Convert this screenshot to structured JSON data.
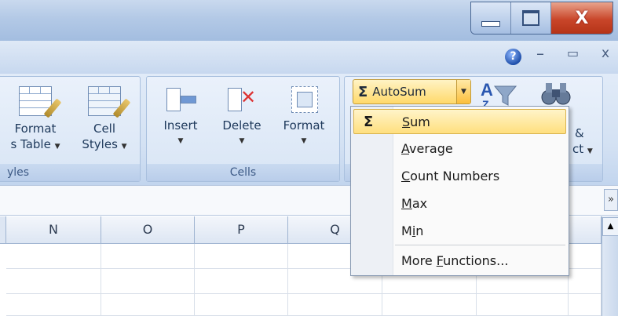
{
  "window": {
    "close_glyph": "X"
  },
  "ribbon": {
    "styles_group": {
      "label": "yles",
      "format_table_line1": "Format",
      "format_table_line2": "s Table",
      "cell_styles_line1": "Cell",
      "cell_styles_line2": "Styles"
    },
    "cells_group": {
      "label": "Cells",
      "insert": "Insert",
      "delete": "Delete",
      "format": "Format"
    },
    "editing_group": {
      "autosum_label": "AutoSum",
      "sort_partial": "&",
      "find_partial": "ct"
    }
  },
  "grid": {
    "columns": [
      "N",
      "O",
      "P",
      "Q"
    ]
  },
  "autosum_menu": {
    "items": [
      {
        "prefix": "",
        "accel": "S",
        "suffix": "um",
        "highlighted": true
      },
      {
        "prefix": "",
        "accel": "A",
        "suffix": "verage"
      },
      {
        "prefix": "",
        "accel": "C",
        "suffix": "ount Numbers"
      },
      {
        "prefix": "",
        "accel": "M",
        "suffix": "ax"
      },
      {
        "prefix": "M",
        "accel": "i",
        "suffix": "n"
      },
      {
        "prefix": "More ",
        "accel": "F",
        "suffix": "unctions..."
      }
    ]
  },
  "colors": {
    "highlight": "#ffdf7e",
    "close_button": "#c9462a",
    "ribbon": "#d3e1f3"
  }
}
